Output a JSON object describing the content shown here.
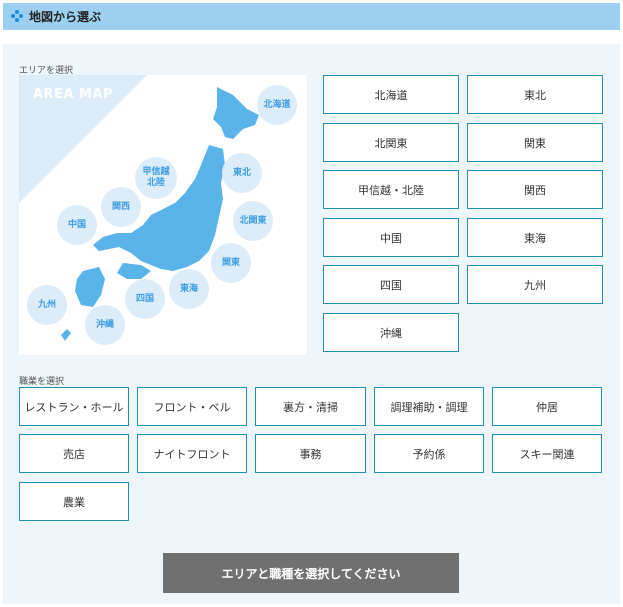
{
  "header": {
    "title": "地図から選ぶ"
  },
  "area_section": {
    "label": "エリアを選択"
  },
  "map": {
    "title": "AREA MAP",
    "regions": {
      "hokkaido": "北海道",
      "tohoku": "東北",
      "kitakanto": "北関東",
      "kanto": "関東",
      "tokai": "東海",
      "koshinetsu": "甲信越\n北陸",
      "kansai": "関西",
      "chugoku": "中国",
      "shikoku": "四国",
      "kyushu": "九州",
      "okinawa": "沖縄"
    }
  },
  "areas": [
    "北海道",
    "東北",
    "北関東",
    "関東",
    "甲信越・北陸",
    "関西",
    "中国",
    "東海",
    "四国",
    "九州",
    "沖縄"
  ],
  "job_section": {
    "label": "職業を選択"
  },
  "jobs": [
    "レストラン・ホール",
    "フロント・ベル",
    "裏方・清掃",
    "調理補助・調理",
    "仲居",
    "売店",
    "ナイトフロント",
    "事務",
    "予約係",
    "スキー関連",
    "農業"
  ],
  "submit": {
    "label": "エリアと職種を選択してください"
  },
  "colors": {
    "accent": "#1f8fb6",
    "map_land": "#5ab4ea",
    "bubble": "#dcecf9",
    "header": "#9dd0f0"
  }
}
